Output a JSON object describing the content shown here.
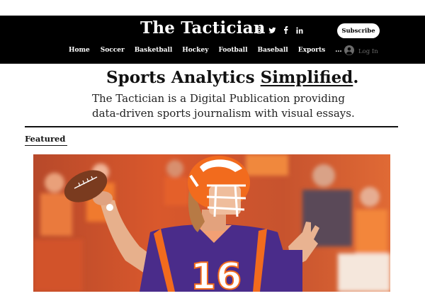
{
  "header": {
    "site_title": "The Tactician",
    "subscribe_label": "Subscribe",
    "login_label": "Log In",
    "social": [
      "instagram-icon",
      "twitter-icon",
      "facebook-icon",
      "linkedin-icon"
    ],
    "nav": [
      {
        "label": "Home"
      },
      {
        "label": "Soccer"
      },
      {
        "label": "Basketball"
      },
      {
        "label": "Hockey"
      },
      {
        "label": "Football"
      },
      {
        "label": "Baseball"
      },
      {
        "label": "Exports"
      },
      {
        "label": "..."
      }
    ]
  },
  "hero": {
    "headline_prefix": "Sports Analytics ",
    "headline_emphasis": "Simplified",
    "headline_suffix": ".",
    "subtitle_line1": "The Tactician is a Digital Publication providing",
    "subtitle_line2": "data-driven sports journalism with visual essays."
  },
  "featured": {
    "section_label": "Featured",
    "jersey_number": "16"
  },
  "colors": {
    "header_bg": "#000000",
    "jersey_purple": "#4a2c8a",
    "jersey_orange": "#f26b1d",
    "stadium_orange": "#c94a22"
  }
}
